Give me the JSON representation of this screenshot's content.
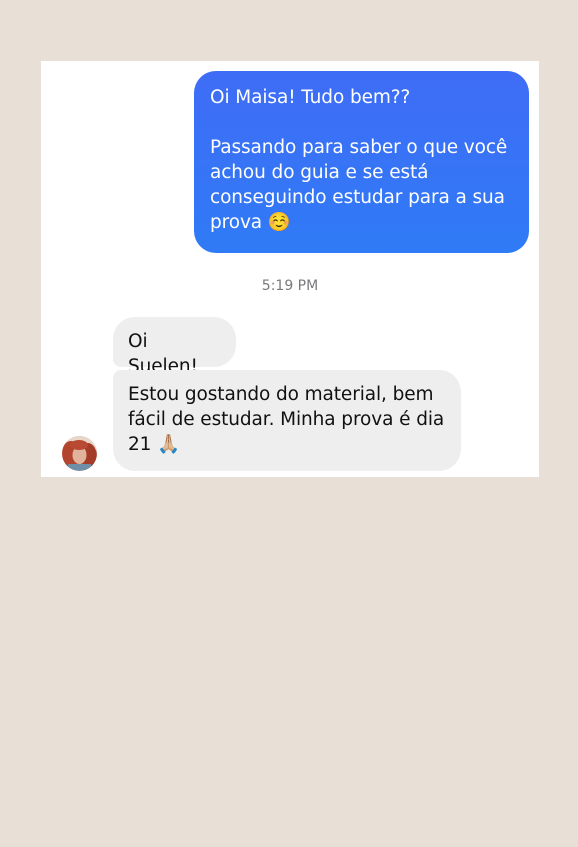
{
  "conversation": {
    "outgoing": {
      "text": "Oi Maisa! Tudo bem??\n\nPassando para saber o que você achou do guia e se está conseguindo estudar para a sua prova ☺️"
    },
    "timestamp": "5:19 PM",
    "incoming": [
      {
        "text": "Oi Suelen!"
      },
      {
        "text": "Estou gostando do material, bem fácil de estudar. Minha prova é dia 21 🙏🏼"
      }
    ],
    "contact": {
      "avatar_icon": "contact-avatar-photo"
    }
  },
  "colors": {
    "page_background": "#e8e0d7",
    "outgoing_bubble": "#3a72f6",
    "incoming_bubble": "#eeeeee"
  }
}
